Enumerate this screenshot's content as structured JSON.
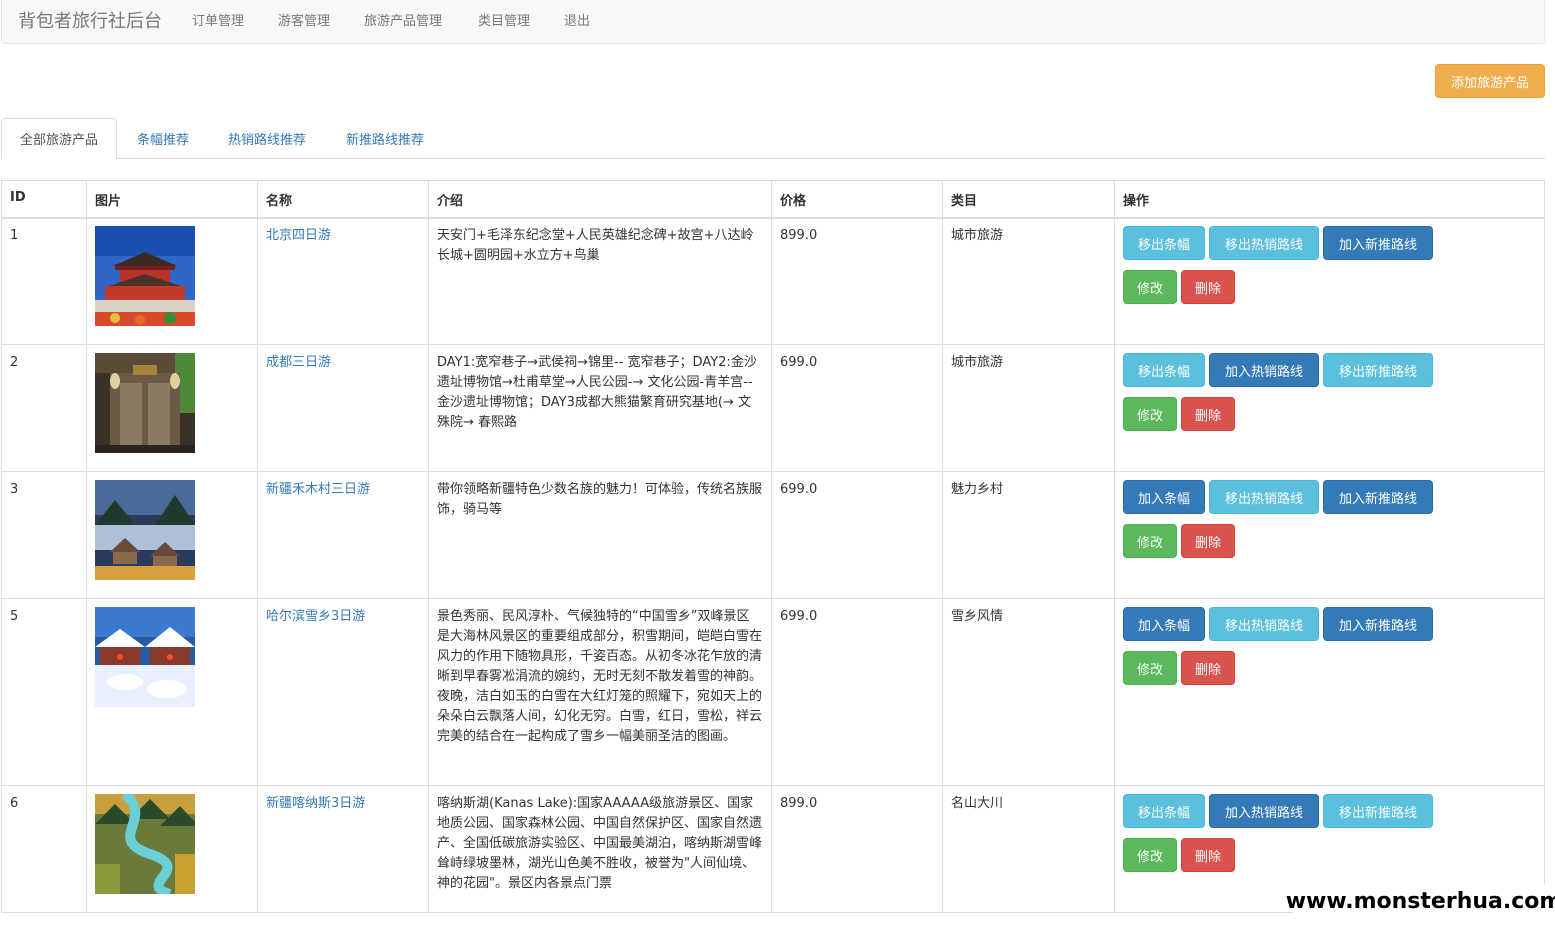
{
  "navbar": {
    "brand": "背包者旅行社后台",
    "links": [
      "订单管理",
      "游客管理",
      "旅游产品管理",
      "类目管理",
      "退出"
    ]
  },
  "add_button": "添加旅游产品",
  "tabs": [
    "全部旅游产品",
    "条幅推荐",
    "热销路线推荐",
    "新推路线推荐"
  ],
  "table": {
    "headers": [
      "ID",
      "图片",
      "名称",
      "介绍",
      "价格",
      "类目",
      "操作"
    ],
    "rows": [
      {
        "id": "1",
        "name": "北京四日游",
        "intro": "天安门+毛泽东纪念堂+人民英雄纪念碑+故宫+八达岭长城+圆明园+水立方+鸟巢",
        "price": "899.0",
        "category": "城市旅游",
        "banner_btn": "移出条幅",
        "hot_btn": "移出热销路线",
        "new_btn": "加入新推路线",
        "edit_btn": "修改",
        "delete_btn": "删除",
        "image": "tiananmen"
      },
      {
        "id": "2",
        "name": "成都三日游",
        "intro": "DAY1:宽窄巷子→武侯祠→锦里-- 宽窄巷子；DAY2:金沙遗址博物馆→杜甫草堂→人民公园-→ 文化公园-青羊宫-- 金沙遗址博物馆；DAY3成都大熊猫繁育研究基地(→ 文殊院→ 春熙路",
        "price": "699.0",
        "category": "城市旅游",
        "banner_btn": "移出条幅",
        "hot_btn": "加入热销路线",
        "new_btn": "移出新推路线",
        "edit_btn": "修改",
        "delete_btn": "删除",
        "image": "chengdu-gate"
      },
      {
        "id": "3",
        "name": "新疆禾木村三日游",
        "intro": "带你领略新疆特色少数名族的魅力！可体验，传统名族服饰，骑马等",
        "price": "699.0",
        "category": "魅力乡村",
        "banner_btn": "加入条幅",
        "hot_btn": "移出热销路线",
        "new_btn": "加入新推路线",
        "edit_btn": "修改",
        "delete_btn": "删除",
        "image": "hemu-village"
      },
      {
        "id": "5",
        "name": "哈尔滨雪乡3日游",
        "intro": "景色秀丽、民风淳朴、气候独特的“中国雪乡”双峰景区是大海林风景区的重要组成部分，积雪期间，皑皑白雪在风力的作用下随物具形，千姿百态。从初冬冰花乍放的清晰到早春雾凇涓流的婉约，无时无刻不散发着雪的神韵。夜晚，洁白如玉的白雪在大红灯笼的照耀下，宛如天上的朵朵白云飘落人间，幻化无穷。白雪，红日，雪松，祥云完美的结合在一起构成了雪乡一幅美丽圣洁的图画。",
        "price": "699.0",
        "category": "雪乡风情",
        "banner_btn": "加入条幅",
        "hot_btn": "移出热销路线",
        "new_btn": "加入新推路线",
        "edit_btn": "修改",
        "delete_btn": "删除",
        "image": "snow-town"
      },
      {
        "id": "6",
        "name": "新疆喀纳斯3日游",
        "intro": "喀纳斯湖(Kanas Lake):国家AAAAA级旅游景区、国家地质公园、国家森林公园、中国自然保护区、国家自然遗产、全国低碳旅游实验区、中国最美湖泊，喀纳斯湖雪峰耸峙绿坡墨林，湖光山色美不胜收，被誉为\"人间仙境、神的花园\"。景区内各景点门票",
        "price": "899.0",
        "category": "名山大川",
        "banner_btn": "移出条幅",
        "hot_btn": "加入热销路线",
        "new_btn": "移出新推路线",
        "edit_btn": "修改",
        "delete_btn": "删除",
        "image": "kanas-river"
      }
    ]
  },
  "watermark": "www.monsterhua.com",
  "colors": {
    "info": "#5bc0de",
    "primary": "#337ab7",
    "success": "#5cb85c",
    "danger": "#d9534f",
    "warning": "#f0ad4e",
    "link": "#337ab7"
  }
}
